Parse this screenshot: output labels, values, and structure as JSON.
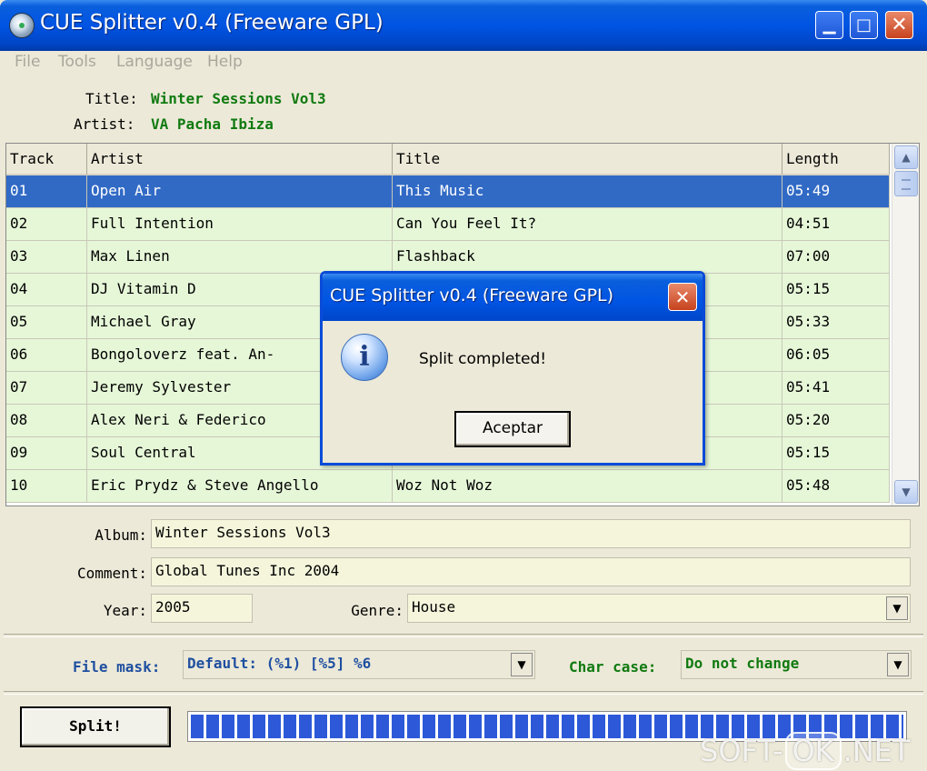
{
  "window": {
    "title": "CUE Splitter v0.4 (Freeware GPL)",
    "minimize_glyph": "▁",
    "maximize_glyph": "□",
    "close_glyph": "✕"
  },
  "menu": {
    "file": "File",
    "tools": "Tools",
    "language": "Language",
    "help": "Help"
  },
  "info": {
    "title_label": "Title:",
    "title_value": "Winter Sessions Vol3",
    "artist_label": "Artist:",
    "artist_value": "VA Pacha Ibiza"
  },
  "table": {
    "headers": {
      "track": "Track",
      "artist": "Artist",
      "title": "Title",
      "length": "Length"
    },
    "rows": [
      {
        "track": "01",
        "artist": "Open Air",
        "title": "This Music",
        "length": "05:49"
      },
      {
        "track": "02",
        "artist": "Full Intention",
        "title": "Can You Feel It?",
        "length": "04:51"
      },
      {
        "track": "03",
        "artist": "Max Linen",
        "title": "Flashback",
        "length": "07:00"
      },
      {
        "track": "04",
        "artist": "DJ Vitamin D",
        "title": "",
        "length": "05:15"
      },
      {
        "track": "05",
        "artist": "Michael Gray",
        "title": "",
        "length": "05:33"
      },
      {
        "track": "06",
        "artist": "Bongoloverz feat. An-",
        "title": "",
        "length": "06:05"
      },
      {
        "track": "07",
        "artist": "Jeremy Sylvester",
        "title": "",
        "length": "05:41"
      },
      {
        "track": "08",
        "artist": "Alex Neri & Federico",
        "title": "",
        "length": "05:20"
      },
      {
        "track": "09",
        "artist": "Soul Central",
        "title": "",
        "length": "05:15"
      },
      {
        "track": "10",
        "artist": "Eric Prydz & Steve Angello",
        "title": "Woz Not Woz",
        "length": "05:48"
      }
    ],
    "selected_index": 0
  },
  "fields": {
    "album_label": "Album:",
    "album_value": "Winter Sessions Vol3",
    "comment_label": "Comment:",
    "comment_value": "Global Tunes Inc 2004",
    "year_label": "Year:",
    "year_value": "2005",
    "genre_label": "Genre:",
    "genre_value": "House"
  },
  "options": {
    "file_mask_label": "File mask:",
    "file_mask_value": "Default: (%1) [%5] %6",
    "char_case_label": "Char case:",
    "char_case_value": "Do not change"
  },
  "actions": {
    "split_label": "Split!",
    "progress": 1.0
  },
  "dialog": {
    "title": "CUE Splitter v0.4 (Freeware GPL)",
    "message": "Split completed!",
    "ok_label": "Aceptar",
    "close_glyph": "✕",
    "info_glyph": "i"
  },
  "watermark": {
    "left": "SOFT-",
    "ok": "OK",
    "right": ".NET"
  },
  "colors": {
    "titlebar": "#0054E3",
    "selected_row": "#316AC5",
    "row_bg": "#E6F7D8",
    "green_text": "#107A10",
    "blue_label": "#1F4FA0",
    "progress": "#2D59D9"
  }
}
